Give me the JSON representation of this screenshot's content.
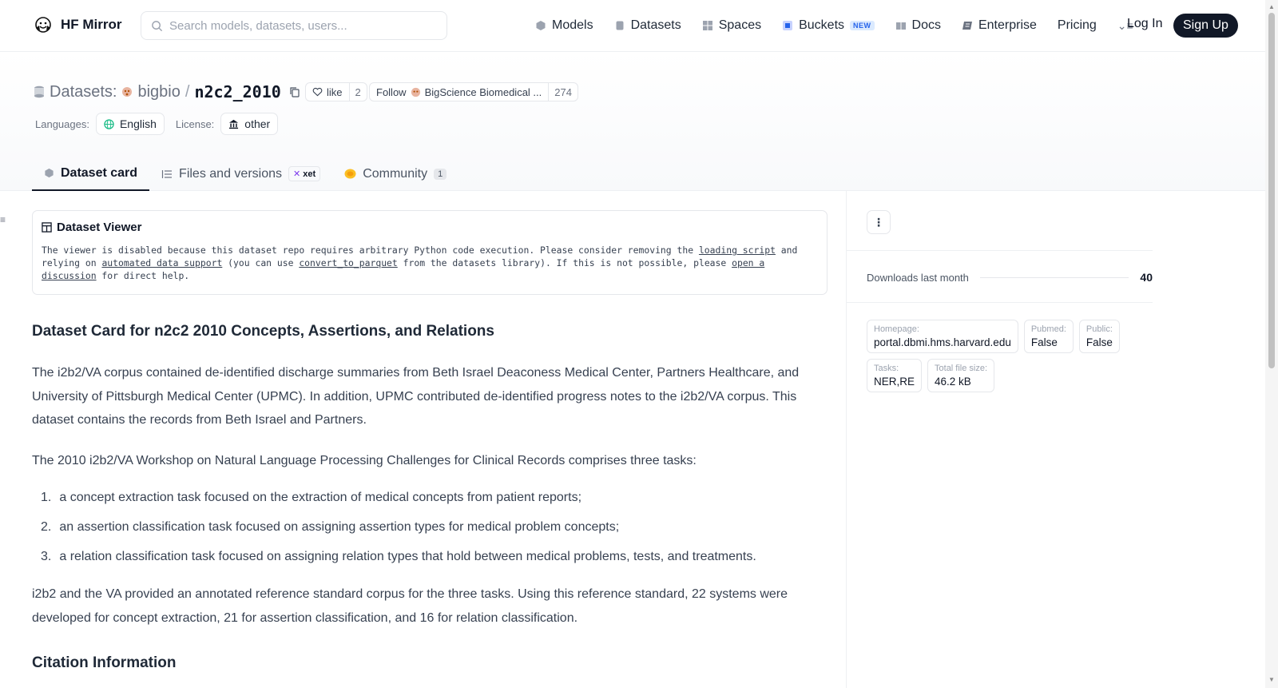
{
  "nav": {
    "logo_text": "HF Mirror",
    "search_placeholder": "Search models, datasets, users...",
    "items": [
      "Models",
      "Datasets",
      "Spaces",
      "Buckets",
      "Docs",
      "Enterprise",
      "Pricing"
    ],
    "new_badge": "NEW",
    "login": "Log In",
    "signup": "Sign Up"
  },
  "header": {
    "kind": "Datasets:",
    "owner": "bigbio",
    "sep": "/",
    "name": "n2c2_2010",
    "like_label": "like",
    "like_count": "2",
    "follow_label": "Follow",
    "follow_org": "BigScience Biomedical ...",
    "follow_count": "274",
    "languages_label": "Languages:",
    "language": "English",
    "license_label": "License:",
    "license": "other"
  },
  "tabs": {
    "card": "Dataset card",
    "files": "Files and versions",
    "xet": "xet",
    "community": "Community",
    "community_count": "1"
  },
  "viewer": {
    "title": "Dataset Viewer",
    "t1": "The viewer is disabled because this dataset repo requires arbitrary Python code execution. Please consider removing the ",
    "link1": "loading script",
    "t2": " and relying on ",
    "link2": "automated data support",
    "t3": " (you can use ",
    "link3": "convert_to_parquet",
    "t4": " from the datasets library). If this is not possible, please ",
    "link4": "open a discussion",
    "t5": " for direct help."
  },
  "card": {
    "heading": "Dataset Card for n2c2 2010 Concepts, Assertions, and Relations",
    "p1": "The i2b2/VA corpus contained de-identified discharge summaries from Beth Israel Deaconess Medical Center, Partners Healthcare, and University of Pittsburgh Medical Center (UPMC). In addition, UPMC contributed de-identified progress notes to the i2b2/VA corpus. This dataset contains the records from Beth Israel and Partners.",
    "p2": "The 2010 i2b2/VA Workshop on Natural Language Processing Challenges for Clinical Records comprises three tasks:",
    "list": [
      {
        "n": "1.",
        "text": "a concept extraction task focused on the extraction of medical concepts from patient reports;"
      },
      {
        "n": "2.",
        "text": "an assertion classification task focused on assigning assertion types for medical problem concepts;"
      },
      {
        "n": "3.",
        "text": "a relation classification task focused on assigning relation types that hold between medical problems, tests, and treatments."
      }
    ],
    "p3": "i2b2 and the VA provided an annotated reference standard corpus for the three tasks. Using this reference standard, 22 systems were developed for concept extraction, 21 for assertion classification, and 16 for relation classification.",
    "h3": "Citation Information"
  },
  "sidebar": {
    "downloads_label": "Downloads last month",
    "downloads_value": "40",
    "meta": [
      {
        "k": "Homepage:",
        "v": "portal.dbmi.hms.harvard.edu"
      },
      {
        "k": "Pubmed:",
        "v": "False"
      },
      {
        "k": "Public:",
        "v": "False"
      },
      {
        "k": "Tasks:",
        "v": "NER,RE"
      },
      {
        "k": "Total file size:",
        "v": "46.2 kB"
      }
    ]
  }
}
